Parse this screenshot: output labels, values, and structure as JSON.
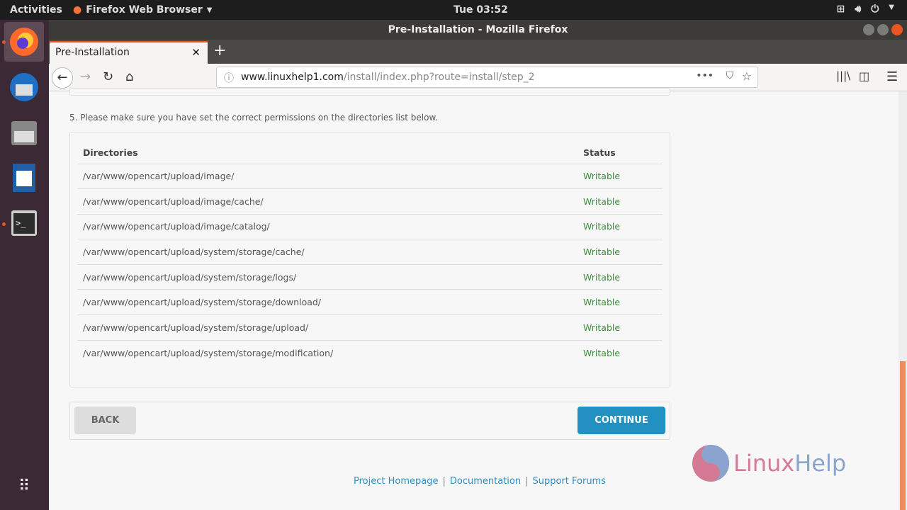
{
  "topbar": {
    "activities": "Activities",
    "app_menu": "Firefox Web Browser",
    "clock": "Tue 03:52"
  },
  "window": {
    "title": "Pre-Installation - Mozilla Firefox"
  },
  "tab": {
    "label": "Pre-Installation"
  },
  "urlbar": {
    "domain": "www.linuxhelp1.com",
    "path": "/install/index.php?route=install/step_2"
  },
  "page": {
    "note": "5. Please make sure you have set the correct permissions on the directories list below.",
    "table": {
      "headers": [
        "Directories",
        "Status"
      ],
      "rows": [
        [
          "/var/www/opencart/upload/image/",
          "Writable"
        ],
        [
          "/var/www/opencart/upload/image/cache/",
          "Writable"
        ],
        [
          "/var/www/opencart/upload/image/catalog/",
          "Writable"
        ],
        [
          "/var/www/opencart/upload/system/storage/cache/",
          "Writable"
        ],
        [
          "/var/www/opencart/upload/system/storage/logs/",
          "Writable"
        ],
        [
          "/var/www/opencart/upload/system/storage/download/",
          "Writable"
        ],
        [
          "/var/www/opencart/upload/system/storage/upload/",
          "Writable"
        ],
        [
          "/var/www/opencart/upload/system/storage/modification/",
          "Writable"
        ]
      ]
    },
    "back_label": "BACK",
    "continue_label": "CONTINUE",
    "footer": [
      "Project Homepage",
      "Documentation",
      "Support Forums"
    ],
    "logo": {
      "part1": "Linux",
      "part2": "Help"
    }
  },
  "colors": {
    "accent": "#e95420",
    "continue": "#2390c2",
    "writable": "#3d8b3d",
    "link": "#2e8fc5"
  }
}
